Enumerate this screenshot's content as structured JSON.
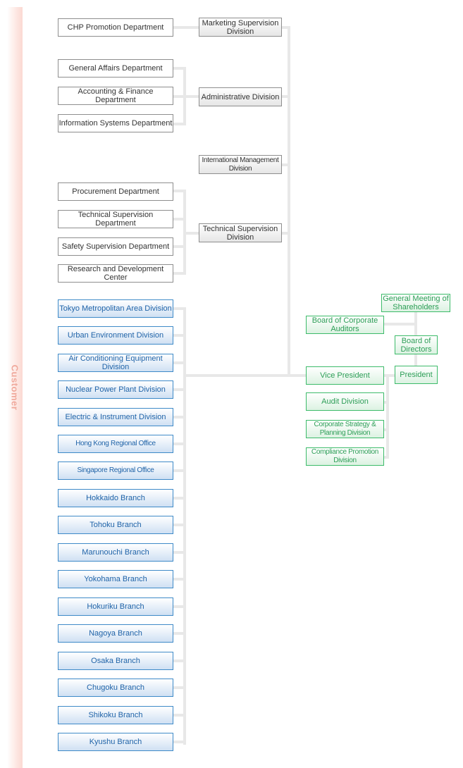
{
  "sidebar": {
    "label": "Customer",
    "color": "#f0a99c"
  },
  "top_management": {
    "general_meeting": "General Meeting of Shareholders",
    "board_auditors": "Board of Corporate Auditors",
    "board_directors": "Board of Directors",
    "president": "President",
    "vice_president": "Vice President",
    "audit": "Audit Division",
    "strategy": "Corporate Strategy & Planning Division",
    "compliance": "Compliance Promotion Division"
  },
  "divisions": {
    "marketing": {
      "name": "Marketing Supervision Division",
      "departments": [
        "CHP Promotion Department"
      ]
    },
    "administrative": {
      "name": "Administrative Division",
      "departments": [
        "General Affairs Department",
        "Accounting & Finance Department",
        "Information Systems Department"
      ]
    },
    "international": {
      "name": "International Management Division",
      "departments": []
    },
    "technical": {
      "name": "Technical Supervision Division",
      "departments": [
        "Procurement Department",
        "Technical Supervision Department",
        "Safety Supervision Department",
        "Research and Development Center"
      ]
    }
  },
  "operating_units": [
    "Tokyo Metropolitan Area Division",
    "Urban Environment Division",
    "Air Conditioning Equipment Division",
    "Nuclear Power Plant Division",
    "Electric & Instrument Division",
    "Hong Kong Regional Office",
    "Singapore Regional Office",
    "Hokkaido Branch",
    "Tohoku Branch",
    "Marunouchi Branch",
    "Yokohama Branch",
    "Hokuriku Branch",
    "Nagoya Branch",
    "Osaka Branch",
    "Chugoku Branch",
    "Shikoku Branch",
    "Kyushu Branch"
  ],
  "colors": {
    "unit_blue": "#1f63a8",
    "management_green": "#2d9e57",
    "connector": "#e8e8e8"
  }
}
